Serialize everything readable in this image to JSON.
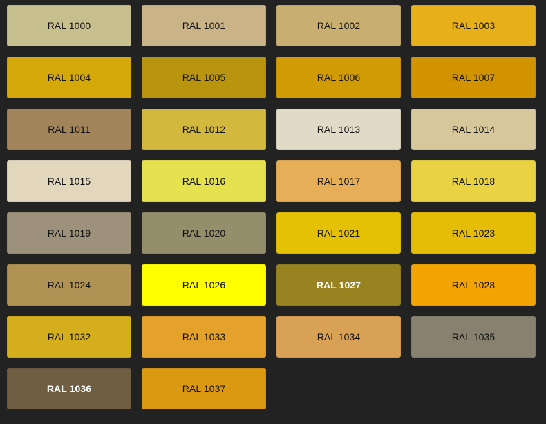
{
  "swatches": [
    {
      "label": "RAL 1000",
      "color": "#C8BF8E"
    },
    {
      "label": "RAL 1001",
      "color": "#C9B387"
    },
    {
      "label": "RAL 1002",
      "color": "#C8AE70"
    },
    {
      "label": "RAL 1003",
      "color": "#E7B01A"
    },
    {
      "label": "RAL 1004",
      "color": "#D5A80A"
    },
    {
      "label": "RAL 1005",
      "color": "#B9950F"
    },
    {
      "label": "RAL 1006",
      "color": "#D09B04"
    },
    {
      "label": "RAL 1007",
      "color": "#D29301"
    },
    {
      "label": "RAL 1011",
      "color": "#A2845A"
    },
    {
      "label": "RAL 1012",
      "color": "#D2B83D"
    },
    {
      "label": "RAL 1013",
      "color": "#E1DAC6"
    },
    {
      "label": "RAL 1014",
      "color": "#D6C89A"
    },
    {
      "label": "RAL 1015",
      "color": "#E2D7BD"
    },
    {
      "label": "RAL 1016",
      "color": "#E6E14F"
    },
    {
      "label": "RAL 1017",
      "color": "#E5AE57"
    },
    {
      "label": "RAL 1018",
      "color": "#E9D343"
    },
    {
      "label": "RAL 1019",
      "color": "#9D917B"
    },
    {
      "label": "RAL 1020",
      "color": "#958E6B"
    },
    {
      "label": "RAL 1021",
      "color": "#E4C104"
    },
    {
      "label": "RAL 1023",
      "color": "#E6BD06"
    },
    {
      "label": "RAL 1024",
      "color": "#AF9254"
    },
    {
      "label": "RAL 1026",
      "color": "#FFFF00"
    },
    {
      "label": "RAL 1027",
      "color": "#988320",
      "light_text": true
    },
    {
      "label": "RAL 1028",
      "color": "#F3A402"
    },
    {
      "label": "RAL 1032",
      "color": "#D5AE1D"
    },
    {
      "label": "RAL 1033",
      "color": "#E4A12B"
    },
    {
      "label": "RAL 1034",
      "color": "#D9A155"
    },
    {
      "label": "RAL 1035",
      "color": "#888170"
    },
    {
      "label": "RAL 1036",
      "color": "#6F5E42",
      "light_text": true
    },
    {
      "label": "RAL 1037",
      "color": "#DB9911"
    }
  ]
}
